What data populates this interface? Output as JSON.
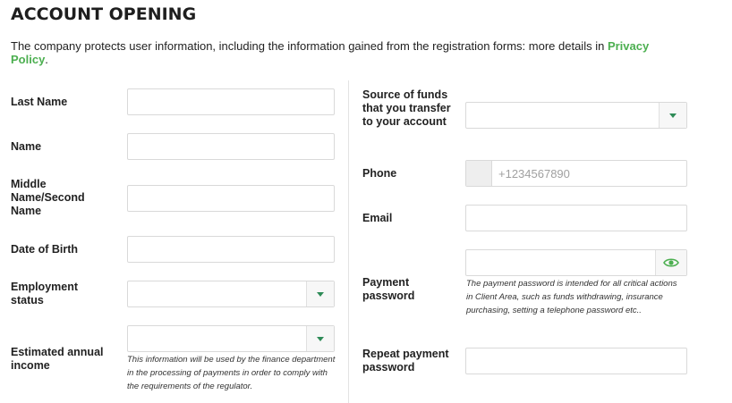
{
  "header": {
    "title": "ACCOUNT OPENING"
  },
  "intro": {
    "text": "The company protects user information, including the information gained from the registration forms: more details in ",
    "link": "Privacy Policy",
    "end": "."
  },
  "left": {
    "last_name": "Last Name",
    "name": "Name",
    "middle_name": "Middle Name/Second Name",
    "dob": "Date of Birth",
    "employment": "Employment status",
    "income": "Estimated annual income",
    "income_hint": "This information will be used by the finance department in the processing of payments in order to comply with the requirements of the regulator."
  },
  "right": {
    "source_funds": "Source of funds that you transfer to your account",
    "phone": "Phone",
    "phone_placeholder": "+1234567890",
    "email": "Email",
    "payment_password": "Payment password",
    "payment_hint": "The payment password is intended for all critical actions in Client Area, such as funds withdrawing, insurance purchasing, setting a telephone password etc..",
    "repeat_password": "Repeat payment password"
  },
  "colors": {
    "accent": "#4caf50",
    "arrow": "#2e8b57"
  },
  "icons": {
    "select": "chevron-down-icon",
    "password_toggle": "eye-icon"
  }
}
